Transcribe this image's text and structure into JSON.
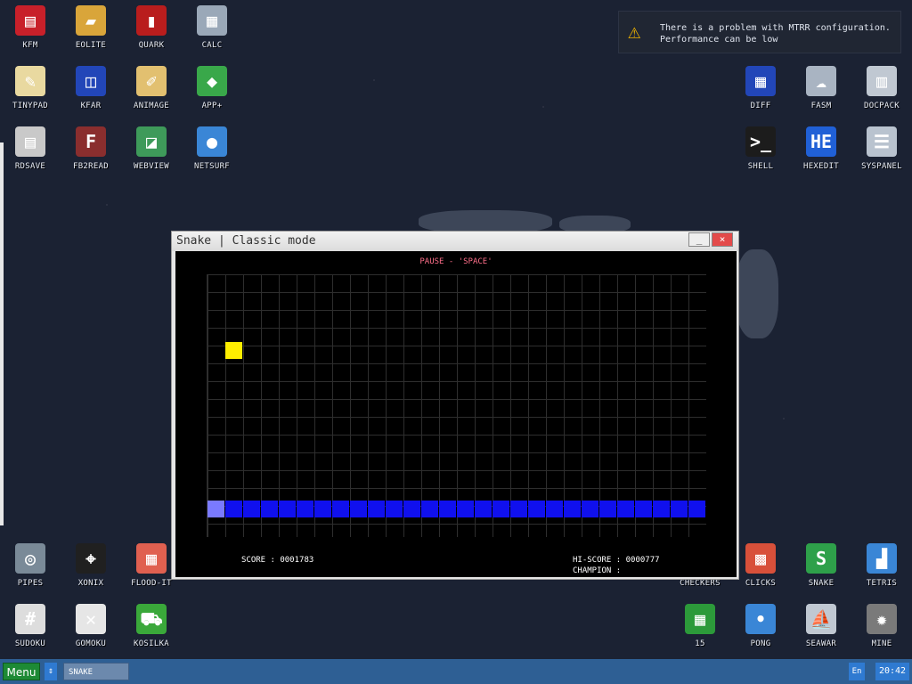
{
  "notification": {
    "line1": "There is a problem with MTRR configuration.",
    "line2": "Performance can be low"
  },
  "desktop_icons": [
    {
      "label": "KFM",
      "icon": "floppy-icon",
      "color": "#c8202a"
    },
    {
      "label": "EOLITE",
      "icon": "folder-icon",
      "color": "#d9a53a"
    },
    {
      "label": "QUARK",
      "icon": "book-icon",
      "color": "#b91d1d"
    },
    {
      "label": "CALC",
      "icon": "calculator-icon",
      "color": "#9aa8b8"
    },
    {
      "label": "TINYPAD",
      "icon": "notepad-icon",
      "color": "#e9d9a0"
    },
    {
      "label": "KFAR",
      "icon": "panels-icon",
      "color": "#2246b8"
    },
    {
      "label": "ANIMAGE",
      "icon": "pencil-icon",
      "color": "#e2c070"
    },
    {
      "label": "APP+",
      "icon": "cube-icon",
      "color": "#39a84a"
    },
    {
      "label": "RDSAVE",
      "icon": "save-disk-icon",
      "color": "#c9c9c9"
    },
    {
      "label": "FB2READ",
      "icon": "fb2-book-icon",
      "color": "#8a2e2e"
    },
    {
      "label": "WEBVIEW",
      "icon": "globe-window-icon",
      "color": "#3e9a5a"
    },
    {
      "label": "NETSURF",
      "icon": "globe-icon",
      "color": "#3a86d6"
    },
    {
      "label": "DIFF",
      "icon": "diff-icon",
      "color": "#2246b8"
    },
    {
      "label": "FASM",
      "icon": "cloud-icon",
      "color": "#a9b4c2"
    },
    {
      "label": "DOCPACK",
      "icon": "cabinet-icon",
      "color": "#c0c8d2"
    },
    {
      "label": "SHELL",
      "icon": "terminal-icon",
      "color": "#1c1c1c"
    },
    {
      "label": "HEXEDIT",
      "icon": "hex-icon",
      "color": "#2060d6"
    },
    {
      "label": "SYSPANEL",
      "icon": "sliders-icon",
      "color": "#b9c3cf"
    },
    {
      "label": "PIPES",
      "icon": "pipes-icon",
      "color": "#7a8a98"
    },
    {
      "label": "XONIX",
      "icon": "xonix-icon",
      "color": "#202020"
    },
    {
      "label": "FLOOD-IT",
      "icon": "flood-icon",
      "color": "#e06050"
    },
    {
      "label": "SUDOKU",
      "icon": "sudoku-icon",
      "color": "#dddddd"
    },
    {
      "label": "GOMOKU",
      "icon": "gomoku-icon",
      "color": "#e6e6e6"
    },
    {
      "label": "KOSILKA",
      "icon": "mower-icon",
      "color": "#3aa83a"
    },
    {
      "label": "CHECKERS",
      "icon": "checkers-icon",
      "color": "#3a3a3a"
    },
    {
      "label": "CLICKS",
      "icon": "clicks-icon",
      "color": "#d8503a"
    },
    {
      "label": "SNAKE",
      "icon": "snake-icon",
      "color": "#2ea04a"
    },
    {
      "label": "TETRIS",
      "icon": "tetris-icon",
      "color": "#3a86d6"
    },
    {
      "label": "15",
      "icon": "fifteen-icon",
      "color": "#2c9a3a"
    },
    {
      "label": "PONG",
      "icon": "pong-icon",
      "color": "#3a86d6"
    },
    {
      "label": "SEAWAR",
      "icon": "ship-icon",
      "color": "#c0c8d2"
    },
    {
      "label": "MINE",
      "icon": "mine-icon",
      "color": "#7a7a7a"
    }
  ],
  "window": {
    "title": "Snake | Classic mode",
    "min_label": "_",
    "close_label": "×"
  },
  "game": {
    "pause_text": "PAUSE - 'SPACE'",
    "score_text": "SCORE : 0001783",
    "hiscore_text": "HI-SCORE : 0000777",
    "champion_text": "CHAMPION :"
  },
  "taskbar": {
    "menu_label": "Menu",
    "switch_label": "⇕",
    "task_label": "SNAKE",
    "lang_label": "En",
    "clock": "20:42"
  }
}
